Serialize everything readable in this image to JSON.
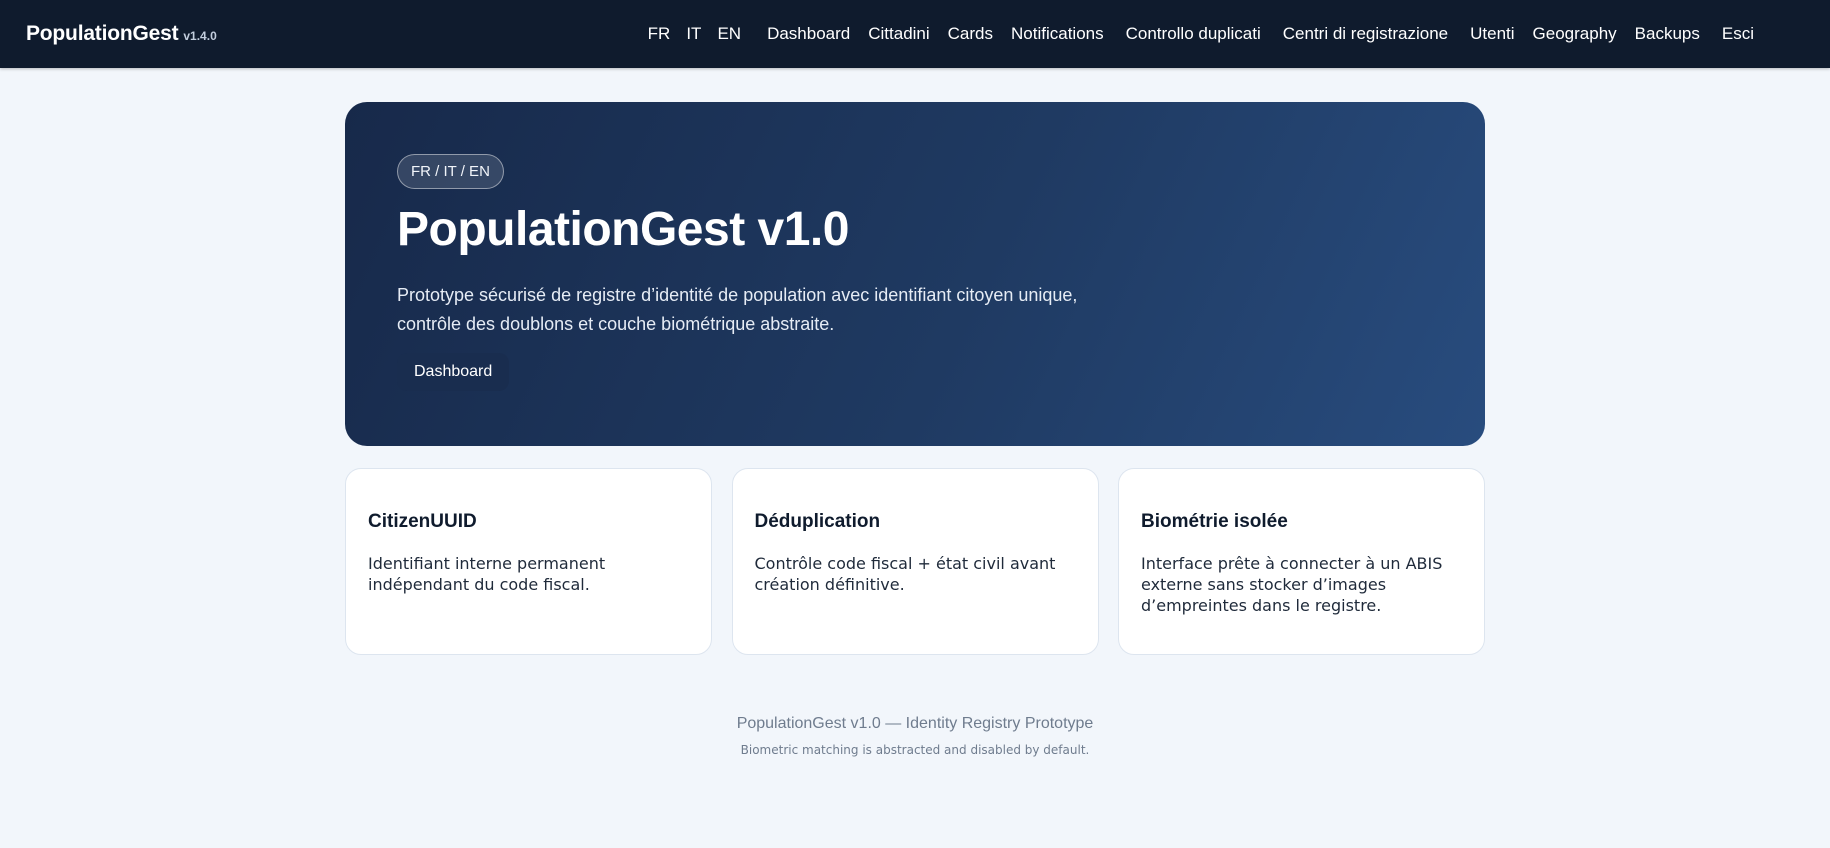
{
  "brand": {
    "name": "PopulationGest",
    "version": "v1.4.0"
  },
  "nav": {
    "languages": [
      "FR",
      "IT",
      "EN"
    ],
    "links": [
      "Dashboard",
      "Cittadini",
      "Cards",
      "Notifications",
      "Controllo duplicati",
      "Centri di registrazione",
      "Utenti",
      "Geography",
      "Backups",
      "Esci"
    ]
  },
  "hero": {
    "badge": "FR / IT / EN",
    "title": "PopulationGest v1.0",
    "description": "Prototype sécurisé de registre d’identité de population avec identifiant citoyen unique, contrôle des doublons et couche biométrique abstraite.",
    "button": "Dashboard"
  },
  "cards": [
    {
      "title": "CitizenUUID",
      "text": "Identifiant interne permanent indépendant du code fiscal."
    },
    {
      "title": "Déduplication",
      "text": "Contrôle code fiscal + état civil avant création définitive."
    },
    {
      "title": "Biométrie isolée",
      "text": "Interface prête à connecter à un ABIS externe sans stocker d’images d’empreintes dans le registre."
    }
  ],
  "footer": {
    "main": "PopulationGest v1.0 — Identity Registry Prototype",
    "sub": "Biometric matching is abstracted and disabled by default."
  },
  "colors": {
    "topbar": "#0f1b2d",
    "hero_start": "#17294a",
    "hero_end": "#284c7e",
    "background": "#f2f6fb"
  }
}
